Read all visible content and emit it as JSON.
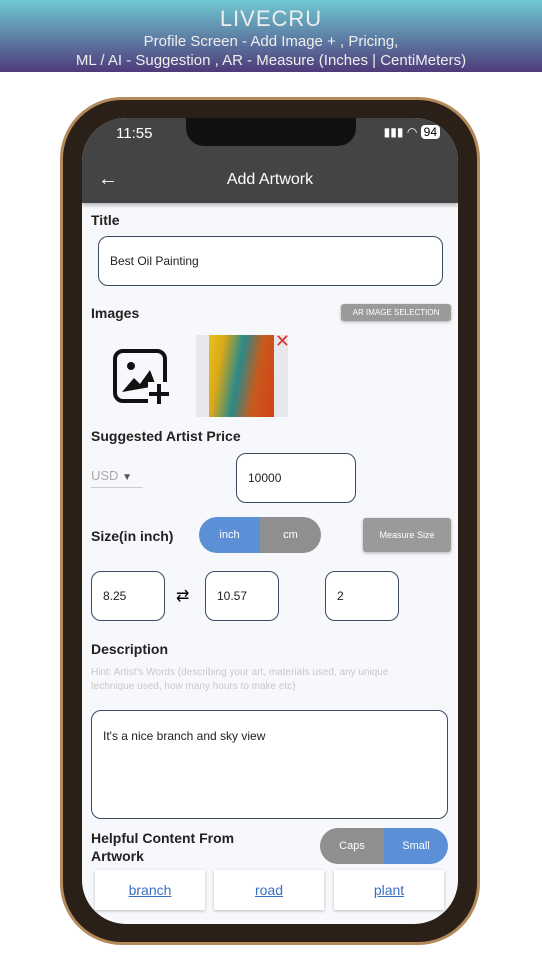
{
  "banner": {
    "title": "LIVECRU",
    "subtitle1": "Profile Screen - Add Image + , Pricing,",
    "subtitle2": "ML / AI - Suggestion , AR - Measure (Inches | CentiMeters)"
  },
  "status": {
    "time": "11:55",
    "battery": "94"
  },
  "appbar": {
    "title": "Add Artwork"
  },
  "title_section": {
    "label": "Title",
    "value": "Best Oil Painting"
  },
  "images": {
    "label": "Images",
    "ar_button": "AR IMAGE SELECTION"
  },
  "price": {
    "label": "Suggested Artist Price",
    "currency": "USD",
    "value": "10000"
  },
  "size": {
    "label": "Size(in inch)",
    "unit_options": [
      "inch",
      "cm"
    ],
    "selected_unit": "inch",
    "measure_button": "Measure Size",
    "width": "8.25",
    "height": "10.57",
    "depth": "2"
  },
  "description": {
    "label": "Description",
    "hint": "Hint: Artist's Words (describing your art, materials used, any unique technique used, how many hours to make etc)",
    "value": "It's a nice branch and sky view"
  },
  "helpful": {
    "label": "Helpful Content From Artwork",
    "case_options": [
      "Caps",
      "Small"
    ],
    "selected_case": "Small",
    "tags": [
      "branch",
      "road",
      "plant"
    ]
  },
  "colors": {
    "accent": "#5b8fd6",
    "appbar": "#444444"
  }
}
